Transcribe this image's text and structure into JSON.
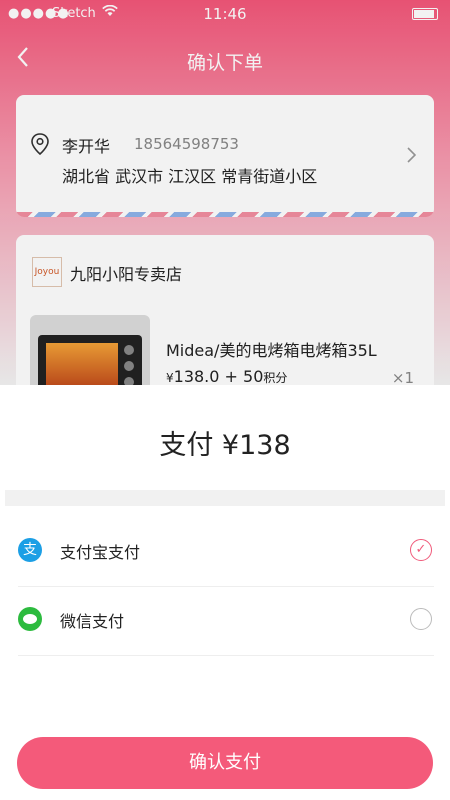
{
  "status_bar": {
    "signal": "●●●●●",
    "carrier": "Sketch",
    "time": "11:46"
  },
  "nav": {
    "title": "确认下单"
  },
  "address": {
    "name": "李开华",
    "phone": "18564598753",
    "full_address": "湖北省 武汉市 江汉区 常青街道小区"
  },
  "store": {
    "logo_text": "Joyou",
    "name": "九阳小阳专卖店",
    "product": {
      "title": "Midea/美的电烤箱电烤箱35L",
      "currency": "¥",
      "price": "138.0",
      "plus_points": "+ 50",
      "points_label": "积分",
      "quantity": "×1"
    }
  },
  "payment_sheet": {
    "title": "支付 ¥138",
    "methods": [
      {
        "label": "支付宝支付",
        "icon": "alipay-icon",
        "icon_char": "支",
        "selected": true
      },
      {
        "label": "微信支付",
        "icon": "wechat-icon",
        "selected": false
      }
    ],
    "confirm_label": "确认支付"
  },
  "colors": {
    "accent": "#f45a7a",
    "alipay": "#1c9fe5",
    "wechat": "#2dbb3f"
  }
}
